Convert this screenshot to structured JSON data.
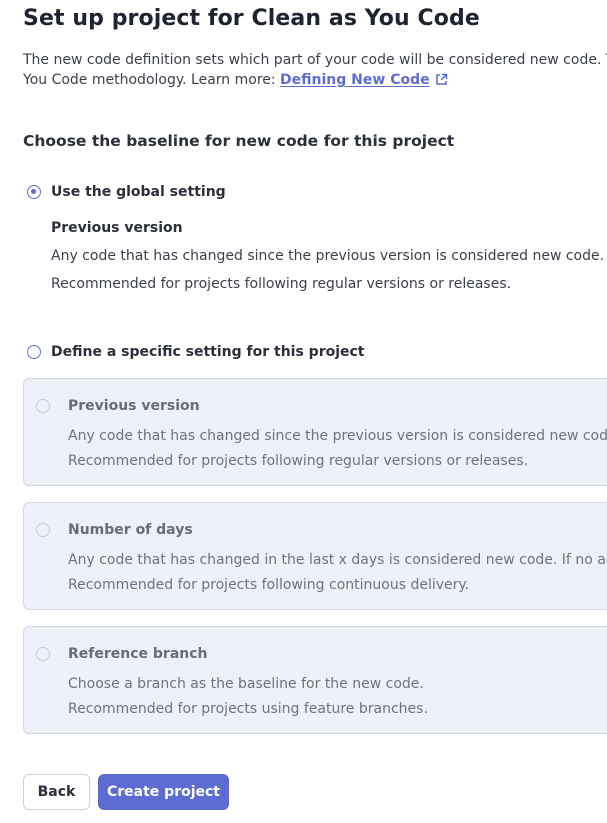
{
  "page": {
    "title": "Set up project for Clean as You Code",
    "intro_line1": "The new code definition sets which part of your code will be considered new code. This",
    "intro_line2_prefix": "You Code methodology. Learn more: ",
    "learn_more_link": "Defining New Code",
    "learn_more_icon": "external-link-icon"
  },
  "baseline": {
    "heading": "Choose the baseline for new code for this project",
    "global_option": {
      "label": "Use the global setting",
      "selected": true,
      "setting_title": "Previous version",
      "setting_desc1": "Any code that has changed since the previous version is considered new code.",
      "setting_desc2": "Recommended for projects following regular versions or releases."
    },
    "specific_option": {
      "label": "Define a specific setting for this project",
      "selected": false,
      "choices": [
        {
          "title": "Previous version",
          "desc1": "Any code that has changed since the previous version is considered new code.",
          "desc2": "Recommended for projects following regular versions or releases."
        },
        {
          "title": "Number of days",
          "desc1": "Any code that has changed in the last x days is considered new code. If no action",
          "desc2": "Recommended for projects following continuous delivery."
        },
        {
          "title": "Reference branch",
          "desc1": "Choose a branch as the baseline for the new code.",
          "desc2": "Recommended for projects using feature branches."
        }
      ]
    }
  },
  "actions": {
    "back_label": "Back",
    "create_label": "Create project"
  },
  "colors": {
    "accent": "#5d6cd0",
    "card_bg": "#eff1f8"
  }
}
